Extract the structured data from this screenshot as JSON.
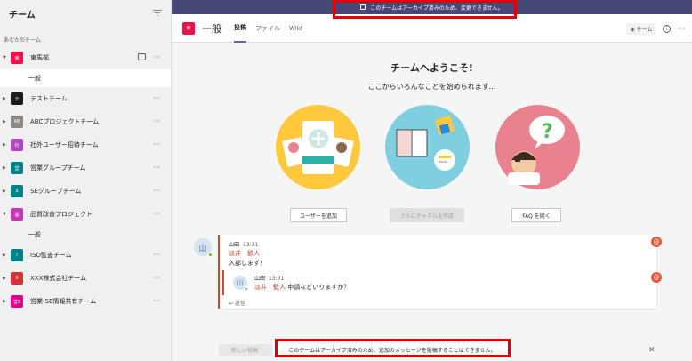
{
  "sidebar": {
    "title": "チーム",
    "section_label": "あなたのチーム",
    "teams": [
      {
        "name": "東馬部",
        "abbr": "東",
        "color": "#e8134b",
        "expanded": true,
        "channels": [
          "一般"
        ]
      },
      {
        "name": "テストチーム",
        "abbr": "テ",
        "color": "#1b1a19",
        "expanded": false,
        "channels": []
      },
      {
        "name": "ABCプロジェクトチーム",
        "abbr": "AB",
        "color": "#8a8886",
        "expanded": false,
        "channels": []
      },
      {
        "name": "社外ユーザー招待チーム",
        "abbr": "社",
        "color": "#b146c2",
        "expanded": false,
        "channels": []
      },
      {
        "name": "営業グループチーム",
        "abbr": "営",
        "color": "#038387",
        "expanded": false,
        "channels": []
      },
      {
        "name": "SEグループチーム",
        "abbr": "S",
        "color": "#038387",
        "expanded": false,
        "channels": []
      },
      {
        "name": "品質改善プロジェクト",
        "abbr": "品",
        "color": "#c239b3",
        "expanded": true,
        "channels": [
          "一般"
        ]
      },
      {
        "name": "ISO監査チーム",
        "abbr": "I",
        "color": "#00828a",
        "expanded": false,
        "channels": []
      },
      {
        "name": "XXX株式会社チーム",
        "abbr": "X",
        "color": "#d13438",
        "expanded": false,
        "channels": []
      },
      {
        "name": "営業-SE情報共有チーム",
        "abbr": "営S",
        "color": "#e3008c",
        "expanded": false,
        "channels": []
      }
    ]
  },
  "archive_banner": "このチームはアーカイブ済みのため、変更できません。",
  "channel": {
    "name": "一般",
    "abbr": "東",
    "tabs": [
      "投稿",
      "ファイル",
      "Wiki"
    ],
    "active_tab": 0,
    "team_chip": "チーム"
  },
  "welcome": {
    "title": "チームへようこそ!",
    "subtitle": "ここからいろんなことを始められます...",
    "buttons": [
      "ユーザーを追加",
      "さらにチャネルを作成",
      "FAQ を開く"
    ]
  },
  "post": {
    "author": "山田",
    "avatar_text": "山",
    "time": "13:31",
    "mention": "淡井　歓人",
    "body": "入部します！",
    "reply": {
      "author": "山田",
      "avatar_text": "山",
      "time": "13:31",
      "mention": "淡井　歓人",
      "body": "申請などいりますか？"
    },
    "reply_label": "返信",
    "at_symbol": "@"
  },
  "compose": {
    "ghost_label": "新しい投稿",
    "archive_note": "このチームはアーカイブ済みのため、追加のメッセージを投稿することはできません。",
    "close": "✕"
  },
  "colors": {
    "accent": "#6264a7",
    "highlight": "#e00000",
    "mention": "#cc4a31"
  }
}
